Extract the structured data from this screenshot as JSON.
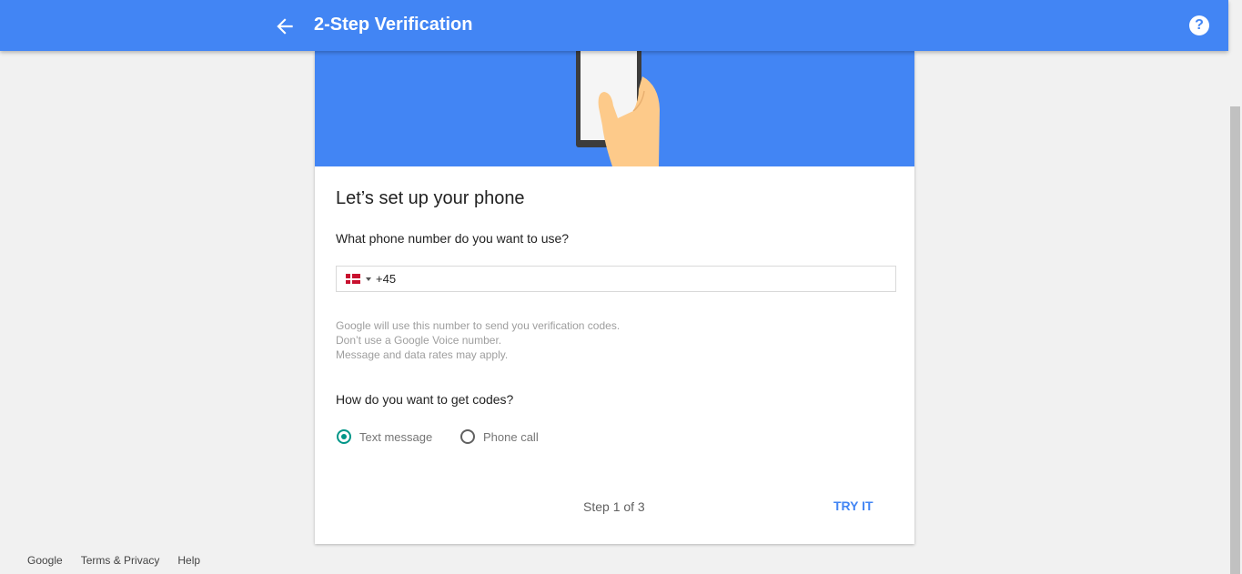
{
  "header": {
    "title": "2-Step Verification",
    "back_icon": "arrow-left-icon",
    "help_glyph": "?"
  },
  "colors": {
    "brand_blue": "#4285f4",
    "radio_teal": "#009688"
  },
  "card": {
    "heading": "Let’s set up your phone",
    "phone_question": "What phone number do you want to use?",
    "phone": {
      "country_flag": "denmark-flag-icon",
      "value": "+45"
    },
    "info_lines": [
      "Google will use this number to send you verification codes.",
      "Don’t use a Google Voice number.",
      "Message and data rates may apply."
    ],
    "codes_question": "How do you want to get codes?",
    "options": [
      {
        "label": "Text message",
        "selected": true
      },
      {
        "label": "Phone call",
        "selected": false
      }
    ],
    "step_text": "Step 1 of 3",
    "try_label": "TRY IT"
  },
  "footer": {
    "links": [
      "Google",
      "Terms & Privacy",
      "Help"
    ]
  }
}
